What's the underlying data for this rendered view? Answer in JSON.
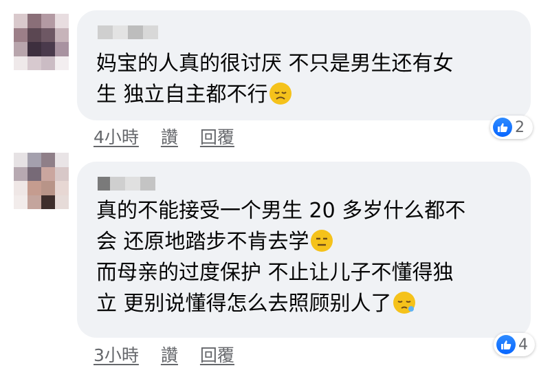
{
  "comments": [
    {
      "lines": [
        "妈宝的人真的很讨厌 不只是男生还有女",
        "生 独立自主都不行"
      ],
      "emoji": "disappointed-face",
      "time": "4小時",
      "like_label": "讚",
      "reply_label": "回覆",
      "reaction_count": "2"
    },
    {
      "lines": [
        "真的不能接受一个男生 20 多岁什么都不",
        "会 还原地踏步不肯去学",
        "而母亲的过度保护 不止让儿子不懂得独",
        "立 更别说懂得怎么去照顾别人了"
      ],
      "emoji": "expressionless-face",
      "emoji2": "sleepy-face",
      "time": "3小時",
      "like_label": "讚",
      "reply_label": "回覆",
      "reaction_count": "4"
    }
  ],
  "colors": {
    "bubble": "#f0f2f5",
    "meta_text": "#65676b",
    "like_blue": "#0866ff",
    "emoji_yellow": "#f5c21b"
  }
}
